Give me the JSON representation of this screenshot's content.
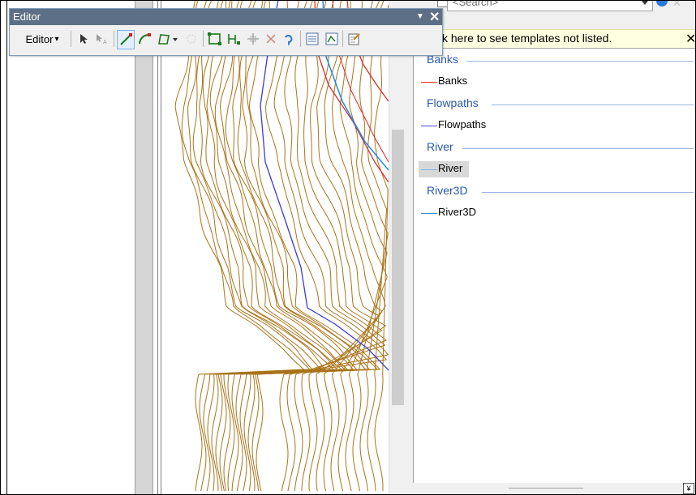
{
  "editor_toolbar": {
    "title": "Editor",
    "menu_label": "Editor",
    "menu_arrow": "▾",
    "dropdown_glyph": "▼",
    "close_glyph": "✕",
    "tools": [
      {
        "name": "edit-tool-icon"
      },
      {
        "name": "edit-annotation-tool-icon"
      },
      {
        "name": "straight-segment-icon"
      },
      {
        "name": "end-point-arc-icon"
      },
      {
        "name": "construction-tools-icon"
      },
      {
        "name": "cut-polygons-icon"
      },
      {
        "name": "split-tool-icon"
      },
      {
        "name": "rotate-tool-icon"
      },
      {
        "name": "sketch-properties-icon"
      },
      {
        "name": "reshape-feature-icon"
      },
      {
        "name": "create-features-icon"
      }
    ]
  },
  "templates_panel": {
    "search_placeholder": "<Search>",
    "banner_text": "k here to see templates not listed.",
    "banner_close": "✕",
    "groups": [
      {
        "header": "Banks",
        "item": "Banks",
        "color": "#e52b2b",
        "selected": false
      },
      {
        "header": "Flowpaths",
        "item": "Flowpaths",
        "color": "#4b4bcf",
        "selected": false
      },
      {
        "header": "River",
        "item": "River",
        "color": "#7fb7e8",
        "selected": true
      },
      {
        "header": "River3D",
        "item": "River3D",
        "color": "#3c8ae0",
        "selected": false
      }
    ],
    "collapse_glyph": "¥"
  },
  "map": {
    "contour_color": "#a9741a",
    "flowpath_color": "#3c3cd2",
    "bank_color": "#e02020",
    "river_color": "#1a8de8"
  }
}
